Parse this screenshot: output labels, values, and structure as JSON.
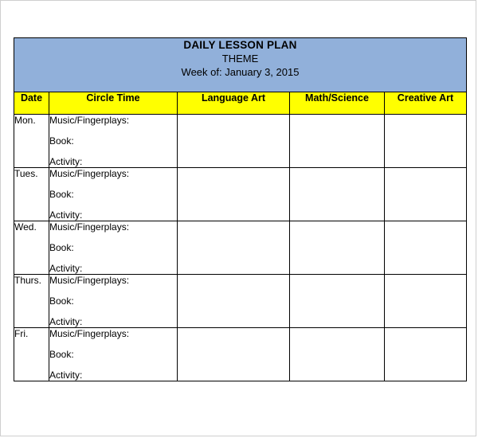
{
  "document": {
    "title_main": "DAILY LESSON PLAN",
    "title_theme": "THEME",
    "title_week": "Week of: January 3, 2015"
  },
  "colors": {
    "header_band": "#91B0DA",
    "column_header": "#FFFF00",
    "grid_line": "#000000",
    "page_border": "#CFCFCF",
    "text": "#000000"
  },
  "table": {
    "columns": [
      {
        "key": "date",
        "label": "Date"
      },
      {
        "key": "circle_time",
        "label": "Circle Time"
      },
      {
        "key": "language_art",
        "label": "Language Art"
      },
      {
        "key": "math_science",
        "label": "Math/Science"
      },
      {
        "key": "creative_art",
        "label": "Creative Art"
      }
    ],
    "circle_time_prompts": [
      "Music/Fingerplays:",
      "Book:",
      "Activity:"
    ],
    "rows": [
      {
        "date": "Mon.",
        "circle_time": [
          "Music/Fingerplays:",
          "Book:",
          "Activity:"
        ],
        "language_art": "",
        "math_science": "",
        "creative_art": ""
      },
      {
        "date": "Tues.",
        "circle_time": [
          "Music/Fingerplays:",
          "Book:",
          "Activity:"
        ],
        "language_art": "",
        "math_science": "",
        "creative_art": ""
      },
      {
        "date": "Wed.",
        "circle_time": [
          "Music/Fingerplays:",
          "Book:",
          "Activity:"
        ],
        "language_art": "",
        "math_science": "",
        "creative_art": ""
      },
      {
        "date": "Thurs.",
        "circle_time": [
          "Music/Fingerplays:",
          "Book:",
          "Activity:"
        ],
        "language_art": "",
        "math_science": "",
        "creative_art": ""
      },
      {
        "date": "Fri.",
        "circle_time": [
          "Music/Fingerplays:",
          "Book:",
          "Activity:"
        ],
        "language_art": "",
        "math_science": "",
        "creative_art": ""
      }
    ]
  }
}
